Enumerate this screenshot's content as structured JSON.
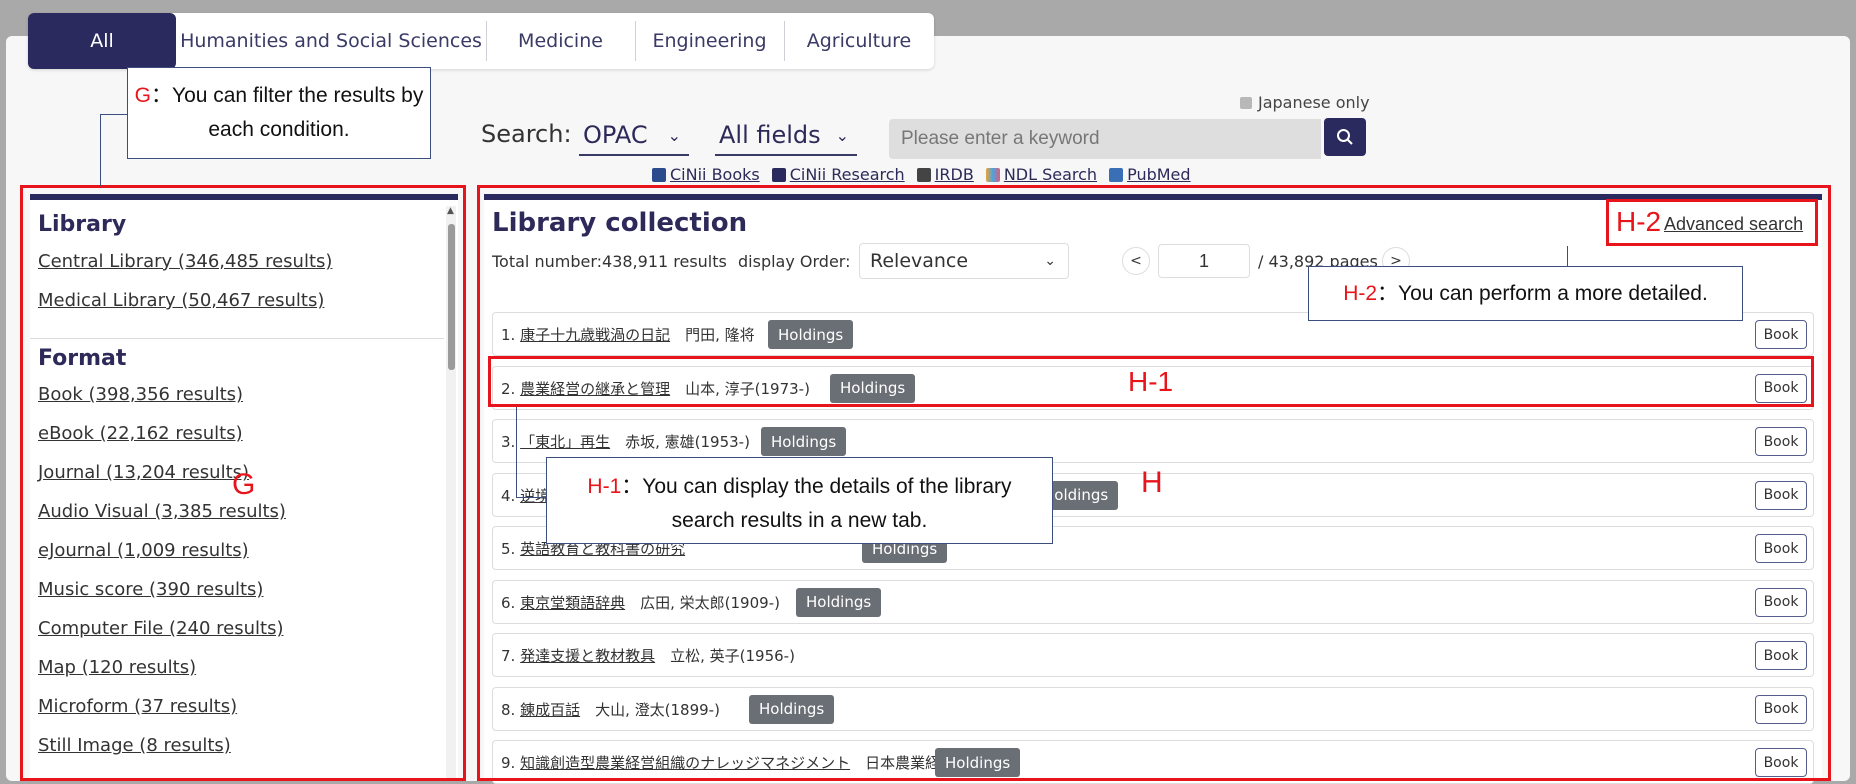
{
  "tabs": [
    "All",
    "Humanities and Social Sciences",
    "Medicine",
    "Engineering",
    "Agriculture"
  ],
  "search": {
    "label": "Search:",
    "source": "OPAC",
    "field": "All fields",
    "placeholder": "Please enter a keyword",
    "japanese_only": "Japanese only"
  },
  "external_links": [
    "CiNii Books",
    "CiNii Research",
    "IRDB",
    "NDL Search",
    "PubMed"
  ],
  "sidebar": {
    "library_heading": "Library",
    "library_items": [
      "Central Library (346,485 results)",
      "Medical Library (50,467 results)"
    ],
    "format_heading": "Format",
    "format_items": [
      "Book (398,356 results)",
      "eBook (22,162 results)",
      "Journal (13,204 results)",
      "Audio Visual (3,385 results)",
      "eJournal (1,009 results)",
      "Music score (390 results)",
      "Computer File (240 results)",
      "Map (120 results)",
      "Microform (37 results)",
      "Still Image (8 results)"
    ]
  },
  "main": {
    "title": "Library collection",
    "advanced_search": "Advanced search",
    "total": "Total number:438,911 results",
    "order_label": "display Order:",
    "order_value": "Relevance",
    "page_current": "1",
    "page_total": "/ 43,892 pages",
    "prev": "<",
    "next": ">",
    "holdings_label": "Holdings",
    "book_label": "Book",
    "results": [
      {
        "num": "1.",
        "title": "康子十九歳戦渦の日記",
        "author": "門田, 隆将",
        "holdings": true
      },
      {
        "num": "2.",
        "title": "農業経営の継承と管理",
        "author": "山本, 淳子(1973-)",
        "holdings": true
      },
      {
        "num": "3.",
        "title": "「東北」再生",
        "author": "赤坂, 憲雄(1953-)",
        "holdings": true
      },
      {
        "num": "4.",
        "title": "逆境",
        "author": "",
        "holdings": true
      },
      {
        "num": "5.",
        "title": "英語教育と教科書の研究",
        "author": "",
        "holdings": true
      },
      {
        "num": "6.",
        "title": "東京堂類語辞典",
        "author": "広田, 栄太郎(1909-)",
        "holdings": true
      },
      {
        "num": "7.",
        "title": "発達支援と教材教具",
        "author": "立松, 英子(1956-)",
        "holdings": false
      },
      {
        "num": "8.",
        "title": "錬成百話",
        "author": "大山, 澄太(1899-)",
        "holdings": true
      },
      {
        "num": "9.",
        "title": "知識創造型農業経営組織のナレッジマネジメント",
        "author": "日本農業経営学会",
        "holdings": true
      }
    ]
  },
  "annotations": {
    "g_tag": "G",
    "g_text": "：You can filter the results by each condition.",
    "h_tag": "H",
    "h1_tag": "H-1",
    "h1_text": "：You can display the details of the library search results in a new tab.",
    "h2_tag": "H-2",
    "h2_text": "：You can perform a more detailed."
  }
}
